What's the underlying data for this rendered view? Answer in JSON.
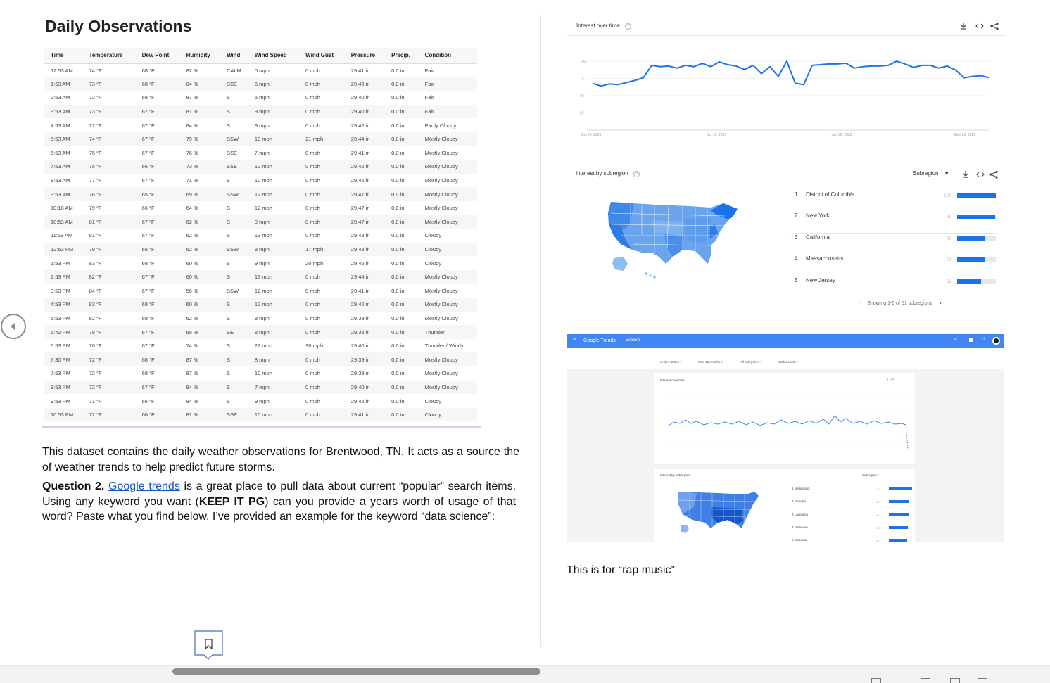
{
  "left_page": {
    "title": "Daily Observations",
    "table": {
      "headers": [
        "Time",
        "Temperature",
        "Dew Point",
        "Humidity",
        "Wind",
        "Wind Speed",
        "Wind Gust",
        "Pressure",
        "Precip.",
        "Condition"
      ],
      "rows": [
        [
          "12:53 AM",
          "74 °F",
          "68 °F",
          "82 %",
          "CALM",
          "0 mph",
          "0 mph",
          "29.41 in",
          "0.0 in",
          "Fair"
        ],
        [
          "1:53 AM",
          "73 °F",
          "68 °F",
          "84 %",
          "SSE",
          "6 mph",
          "0 mph",
          "29.40 in",
          "0.0 in",
          "Fair"
        ],
        [
          "2:53 AM",
          "72 °F",
          "68 °F",
          "87 %",
          "S",
          "5 mph",
          "0 mph",
          "29.40 in",
          "0.0 in",
          "Fair"
        ],
        [
          "3:53 AM",
          "73 °F",
          "67 °F",
          "81 %",
          "S",
          "9 mph",
          "0 mph",
          "29.40 in",
          "0.0 in",
          "Fair"
        ],
        [
          "4:53 AM",
          "72 °F",
          "67 °F",
          "84 %",
          "S",
          "9 mph",
          "0 mph",
          "29.42 in",
          "0.0 in",
          "Partly Cloudy"
        ],
        [
          "5:53 AM",
          "74 °F",
          "67 °F",
          "79 %",
          "SSW",
          "10 mph",
          "21 mph",
          "29.44 in",
          "0.0 in",
          "Mostly Cloudy"
        ],
        [
          "6:53 AM",
          "75 °F",
          "67 °F",
          "76 %",
          "SSE",
          "7 mph",
          "0 mph",
          "29.41 in",
          "0.0 in",
          "Mostly Cloudy"
        ],
        [
          "7:53 AM",
          "75 °F",
          "66 °F",
          "73 %",
          "SSE",
          "12 mph",
          "0 mph",
          "29.42 in",
          "0.0 in",
          "Mostly Cloudy"
        ],
        [
          "8:53 AM",
          "77 °F",
          "67 °F",
          "71 %",
          "S",
          "10 mph",
          "0 mph",
          "29.46 in",
          "0.0 in",
          "Mostly Cloudy"
        ],
        [
          "9:53 AM",
          "76 °F",
          "65 °F",
          "69 %",
          "SSW",
          "12 mph",
          "0 mph",
          "29.47 in",
          "0.0 in",
          "Mostly Cloudy"
        ],
        [
          "10:18 AM",
          "79 °F",
          "66 °F",
          "64 %",
          "S",
          "12 mph",
          "0 mph",
          "29.47 in",
          "0.0 in",
          "Mostly Cloudy"
        ],
        [
          "10:53 AM",
          "81 °F",
          "67 °F",
          "62 %",
          "S",
          "9 mph",
          "0 mph",
          "29.47 in",
          "0.0 in",
          "Mostly Cloudy"
        ],
        [
          "11:53 AM",
          "81 °F",
          "67 °F",
          "62 %",
          "S",
          "13 mph",
          "0 mph",
          "29.48 in",
          "0.0 in",
          "Cloudy"
        ],
        [
          "12:53 PM",
          "79 °F",
          "65 °F",
          "62 %",
          "SSW",
          "8 mph",
          "17 mph",
          "29.48 in",
          "0.0 in",
          "Cloudy"
        ],
        [
          "1:53 PM",
          "83 °F",
          "68 °F",
          "60 %",
          "S",
          "9 mph",
          "20 mph",
          "29.46 in",
          "0.0 in",
          "Cloudy"
        ],
        [
          "2:53 PM",
          "82 °F",
          "67 °F",
          "60 %",
          "S",
          "13 mph",
          "0 mph",
          "29.44 in",
          "0.0 in",
          "Mostly Cloudy"
        ],
        [
          "3:53 PM",
          "84 °F",
          "67 °F",
          "56 %",
          "SSW",
          "12 mph",
          "0 mph",
          "29.41 in",
          "0.0 in",
          "Mostly Cloudy"
        ],
        [
          "4:53 PM",
          "83 °F",
          "68 °F",
          "60 %",
          "S",
          "12 mph",
          "0 mph",
          "29.40 in",
          "0.0 in",
          "Mostly Cloudy"
        ],
        [
          "5:53 PM",
          "82 °F",
          "68 °F",
          "62 %",
          "S",
          "8 mph",
          "0 mph",
          "29.39 in",
          "0.0 in",
          "Mostly Cloudy"
        ],
        [
          "6:42 PM",
          "78 °F",
          "67 °F",
          "68 %",
          "SE",
          "8 mph",
          "0 mph",
          "29.38 in",
          "0.0 in",
          "Thunder"
        ],
        [
          "6:53 PM",
          "76 °F",
          "67 °F",
          "74 %",
          "S",
          "22 mph",
          "30 mph",
          "29.40 in",
          "0.0 in",
          "Thunder / Windy"
        ],
        [
          "7:30 PM",
          "72 °F",
          "68 °F",
          "87 %",
          "S",
          "8 mph",
          "0 mph",
          "29.39 in",
          "0.0 in",
          "Mostly Cloudy"
        ],
        [
          "7:53 PM",
          "72 °F",
          "68 °F",
          "87 %",
          "S",
          "10 mph",
          "0 mph",
          "29.39 in",
          "0.0 in",
          "Mostly Cloudy"
        ],
        [
          "8:53 PM",
          "72 °F",
          "67 °F",
          "84 %",
          "S",
          "7 mph",
          "0 mph",
          "29.40 in",
          "0.0 in",
          "Mostly Cloudy"
        ],
        [
          "9:53 PM",
          "71 °F",
          "66 °F",
          "84 %",
          "S",
          "9 mph",
          "0 mph",
          "29.42 in",
          "0.0 in",
          "Cloudy"
        ],
        [
          "10:53 PM",
          "72 °F",
          "66 °F",
          "81 %",
          "SSE",
          "10 mph",
          "0 mph",
          "29.41 in",
          "0.0 in",
          "Cloudy"
        ]
      ]
    },
    "para1": "This dataset contains the daily weather observations for Brentwood, TN. It acts as a source the of weather trends to help predict future storms.",
    "q2_label": "Question 2.",
    "q2_link": "Google trends",
    "q2_text_a": " is a great place to pull data about current “popular” search items. Using any keyword you want (",
    "q2_bold": "KEEP IT PG",
    "q2_text_b": ") can you provide a years worth of usage of that word? Paste what you find below. I’ve provided an example for the keyword “data science”:"
  },
  "right_page": {
    "iot": {
      "title": "Interest over time",
      "x_ticks": [
        "Jun 20, 2021",
        "Oct 10, 2021",
        "Jan 30, 2022",
        "May 22, 2022"
      ],
      "y_ticks": [
        "100",
        "75",
        "50",
        "25"
      ]
    },
    "subregion": {
      "title": "Interest by subregion",
      "selector": "Subregion",
      "items": [
        {
          "rank": "1",
          "name": "District of Columbia",
          "value": "100"
        },
        {
          "rank": "2",
          "name": "New York",
          "value": "99"
        },
        {
          "rank": "3",
          "name": "California",
          "value": "72"
        },
        {
          "rank": "4",
          "name": "Massachusetts",
          "value": "71"
        },
        {
          "rank": "5",
          "name": "New Jersey",
          "value": "62"
        }
      ],
      "footer": "Showing 1-5 of 51 subregions"
    },
    "embedded": {
      "brand": "Google Trends",
      "explore": "Explore",
      "filters": [
        "United States ▾",
        "Past 12 months ▾",
        "All categories ▾",
        "Web Search ▾"
      ],
      "iot_title": "Interest over time",
      "sub_title": "Interest by subregion",
      "sub_selector": "Subregion ▾",
      "ranks": [
        {
          "rank": "1",
          "name": "Mississippi",
          "value": "100"
        },
        {
          "rank": "2",
          "name": "Georgia",
          "value": "86"
        },
        {
          "rank": "3",
          "name": "Louisiana",
          "value": "84"
        },
        {
          "rank": "4",
          "name": "Delaware",
          "value": "83"
        },
        {
          "rank": "5",
          "name": "Alabama",
          "value": "80"
        }
      ]
    },
    "caption": "This is for “rap music”"
  },
  "chart_data": [
    {
      "type": "line",
      "title": "Interest over time",
      "x_ticks": [
        "Jun 20, 2021",
        "Oct 10, 2021",
        "Jan 30, 2022",
        "May 22, 2022"
      ],
      "ylim": [
        0,
        100
      ],
      "values": [
        68,
        64,
        67,
        66,
        69,
        72,
        76,
        94,
        92,
        93,
        90,
        94,
        92,
        97,
        92,
        99,
        95,
        93,
        88,
        94,
        82,
        92,
        78,
        100,
        68,
        66,
        94,
        95,
        96,
        96,
        97,
        90,
        92,
        93,
        93,
        94,
        100,
        96,
        91,
        94,
        94,
        90,
        93,
        87,
        76,
        78,
        79,
        76
      ]
    }
  ],
  "colors": {
    "accent": "#1a73e8",
    "gt_header": "#4285f4"
  }
}
